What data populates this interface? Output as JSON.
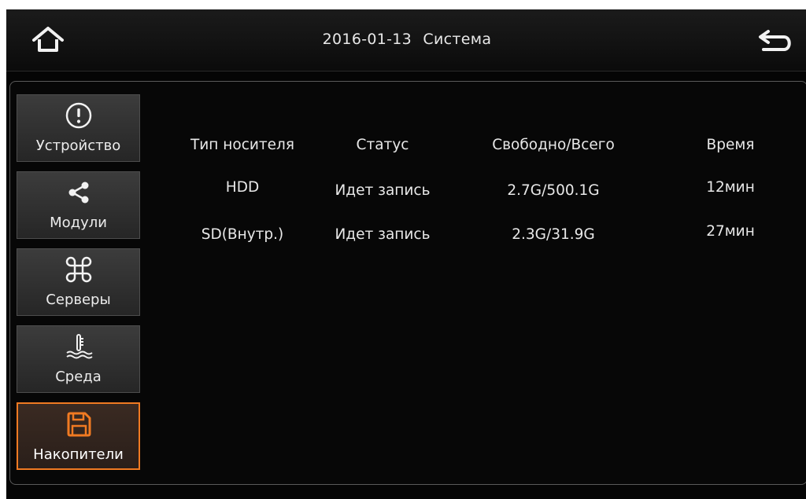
{
  "header": {
    "date": "2016-01-13",
    "title": "Система"
  },
  "icons": {
    "home": "home-icon",
    "back": "back-icon"
  },
  "sidebar": {
    "items": [
      {
        "label": "Устройство",
        "icon": "info-icon"
      },
      {
        "label": "Модули",
        "icon": "share-icon"
      },
      {
        "label": "Серверы",
        "icon": "command-icon"
      },
      {
        "label": "Среда",
        "icon": "temperature-icon"
      },
      {
        "label": "Накопители",
        "icon": "floppy-icon",
        "active": true
      }
    ]
  },
  "storage_table": {
    "columns": [
      "Тип носителя",
      "Статус",
      "Свободно/Всего",
      "Время"
    ],
    "rows": [
      [
        "HDD",
        "Идет запись",
        "2.7G/500.1G",
        "12мин"
      ],
      [
        "SD(Внутр.)",
        "Идет запись",
        "2.3G/31.9G",
        "27мин"
      ]
    ]
  },
  "colors": {
    "accent": "#f07a22",
    "background": "#050505",
    "text": "#e8e8e8"
  }
}
